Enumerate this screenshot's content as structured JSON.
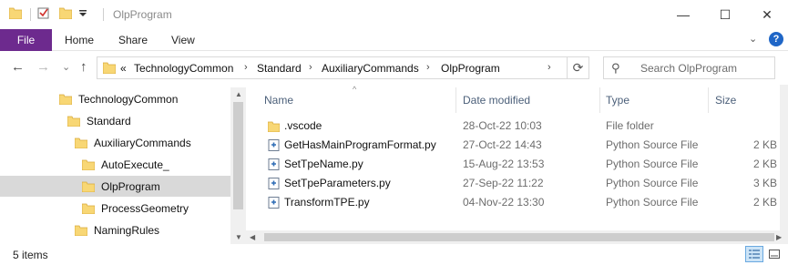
{
  "window": {
    "title": "OlpProgram",
    "minimize_glyph": "—",
    "maximize_glyph": "☐",
    "close_glyph": "✕"
  },
  "ribbon": {
    "tabs": [
      "File",
      "Home",
      "Share",
      "View"
    ],
    "expand_glyph": "⌄",
    "help_glyph": "?"
  },
  "nav": {
    "back_glyph": "←",
    "forward_glyph": "→",
    "recent_glyph": "⌄",
    "up_glyph": "↑",
    "overflow_glyph": "«",
    "breadcrumbs": [
      "TechnologyCommon",
      "Standard",
      "AuxiliaryCommands",
      "OlpProgram"
    ],
    "crumb_separator": "›",
    "refresh_glyph": "⟳",
    "search_placeholder": "Search OlpProgram",
    "search_glyph": "⚲"
  },
  "tree": {
    "items": [
      {
        "label": "TechnologyCommon",
        "selected": false
      },
      {
        "label": "Standard",
        "selected": false
      },
      {
        "label": "AuxiliaryCommands",
        "selected": false
      },
      {
        "label": "AutoExecute_",
        "selected": false
      },
      {
        "label": "OlpProgram",
        "selected": true
      },
      {
        "label": "ProcessGeometry",
        "selected": false
      },
      {
        "label": "NamingRules",
        "selected": false
      }
    ]
  },
  "columns": {
    "name": "Name",
    "date": "Date modified",
    "type": "Type",
    "size": "Size"
  },
  "files": [
    {
      "name": ".vscode",
      "date": "28-Oct-22 10:03",
      "type": "File folder",
      "size": "",
      "icon": "folder-icon"
    },
    {
      "name": "GetHasMainProgramFormat.py",
      "date": "27-Oct-22 14:43",
      "type": "Python Source File",
      "size": "2 KB",
      "icon": "python-file-icon"
    },
    {
      "name": "SetTpeName.py",
      "date": "15-Aug-22 13:53",
      "type": "Python Source File",
      "size": "2 KB",
      "icon": "python-file-icon"
    },
    {
      "name": "SetTpeParameters.py",
      "date": "27-Sep-22 11:22",
      "type": "Python Source File",
      "size": "3 KB",
      "icon": "python-file-icon"
    },
    {
      "name": "TransformTPE.py",
      "date": "04-Nov-22 13:30",
      "type": "Python Source File",
      "size": "2 KB",
      "icon": "python-file-icon"
    }
  ],
  "status": {
    "item_count": "5 items"
  },
  "colors": {
    "file_tab": "#6d2a8e",
    "folder": "#f8d775",
    "selection": "#d9d9d9",
    "header_text": "#4c607a"
  }
}
